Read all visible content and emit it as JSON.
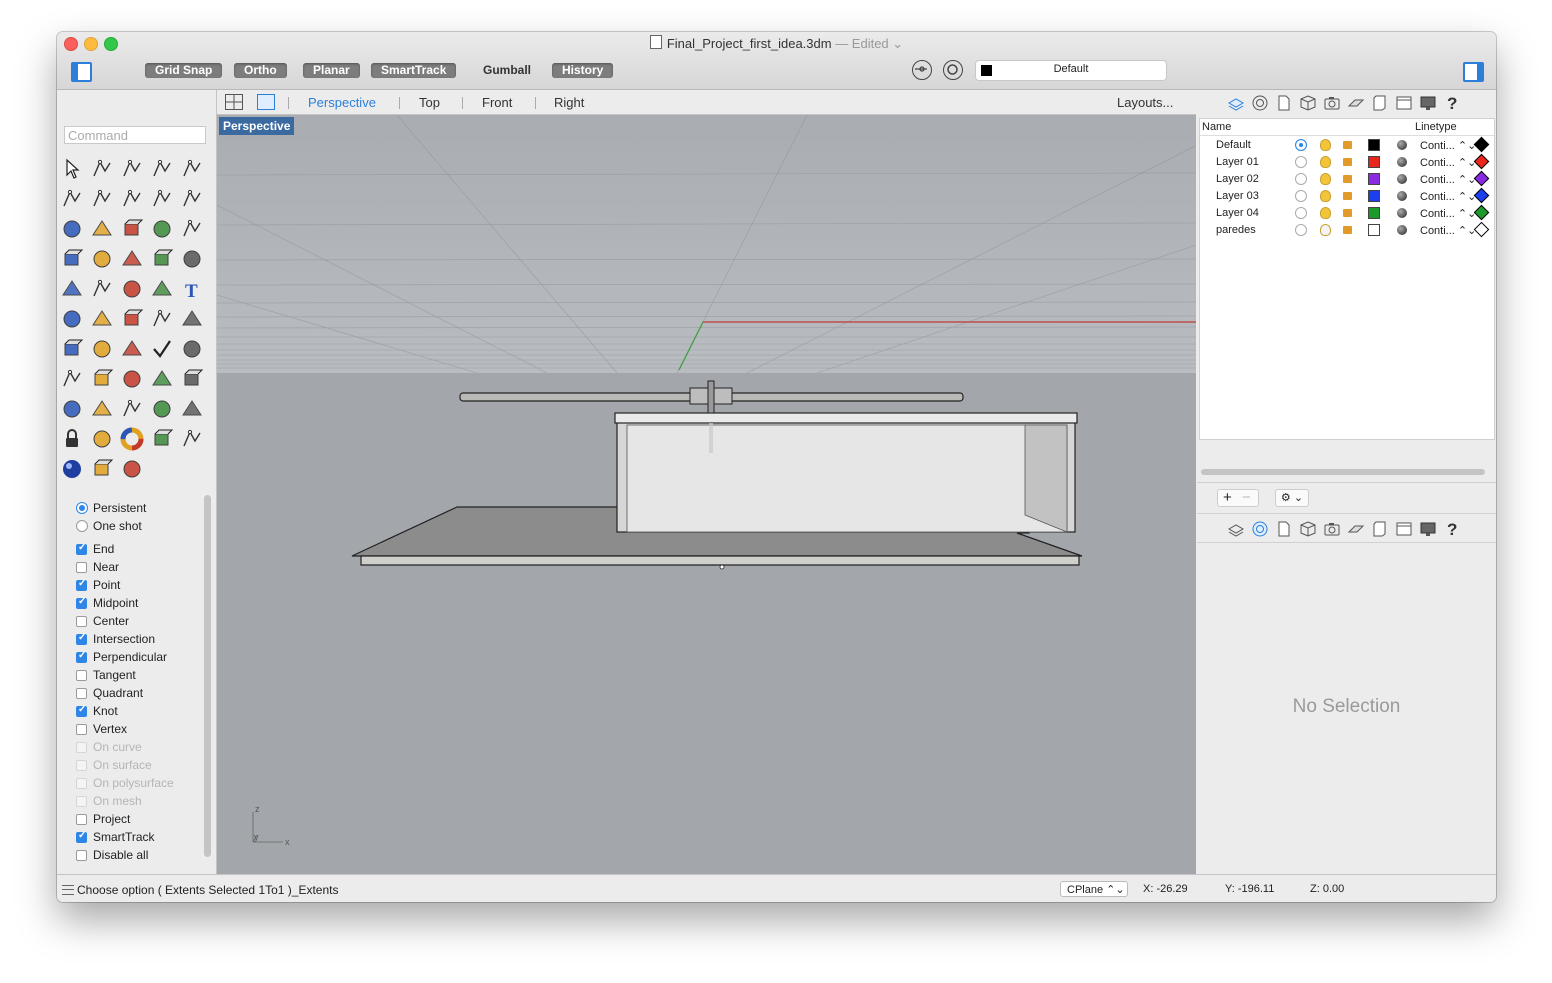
{
  "window": {
    "title": "Final_Project_first_idea.3dm",
    "edited": " — Edited ⌄"
  },
  "toolbar": {
    "grid_snap": "Grid Snap",
    "ortho": "Ortho",
    "planar": "Planar",
    "smarttrack": "SmartTrack",
    "gumball": "Gumball",
    "history": "History",
    "current_layer": "Default",
    "current_layer_color": "#000000"
  },
  "command": {
    "placeholder": "Command"
  },
  "tools": [
    "select-arrow-icon",
    "point-icon",
    "polyline-icon",
    "curve-icon",
    "circle-icon",
    "ellipse-icon",
    "arc-icon",
    "rectangle-icon",
    "polygon-icon",
    "fillet-icon",
    "surface-icon",
    "extrude-icon",
    "box-solid-icon",
    "sphere-icon",
    "cylinder-icon",
    "surface-edit-icon",
    "transform-puzzle-icon",
    "explode-icon",
    "split-icon",
    "offset-icon",
    "boolean-icon",
    "group-icon",
    "rotate-icon",
    "curve-from-object-icon",
    "text-icon",
    "scale-icon",
    "array-icon",
    "dimension-icon",
    "block-icon",
    "plane-icon",
    "grid-icon",
    "gumball-icon",
    "mesh-icon",
    "check-icon",
    "analyze-icon",
    "pan-icon",
    "zoom-icon",
    "zoom-window-icon",
    "zoom-extents-icon",
    "zoom-selected-icon",
    "named-view-icon",
    "car-render-icon",
    "texture-icon",
    "render-icon",
    "light-icon",
    "lock-icon",
    "section-icon",
    "color-wheel-icon",
    "sphere-display-icon",
    "globe-wire-icon",
    "material-ball-icon",
    "cone-icon",
    "layout-icon"
  ],
  "osnap": {
    "persistent": "Persistent",
    "one_shot": "One shot",
    "items": [
      {
        "label": "End",
        "checked": true,
        "enabled": true
      },
      {
        "label": "Near",
        "checked": false,
        "enabled": true
      },
      {
        "label": "Point",
        "checked": true,
        "enabled": true
      },
      {
        "label": "Midpoint",
        "checked": true,
        "enabled": true
      },
      {
        "label": "Center",
        "checked": false,
        "enabled": true
      },
      {
        "label": "Intersection",
        "checked": true,
        "enabled": true
      },
      {
        "label": "Perpendicular",
        "checked": true,
        "enabled": true
      },
      {
        "label": "Tangent",
        "checked": false,
        "enabled": true
      },
      {
        "label": "Quadrant",
        "checked": false,
        "enabled": true
      },
      {
        "label": "Knot",
        "checked": true,
        "enabled": true
      },
      {
        "label": "Vertex",
        "checked": false,
        "enabled": true
      },
      {
        "label": "On curve",
        "checked": false,
        "enabled": false
      },
      {
        "label": "On surface",
        "checked": false,
        "enabled": false
      },
      {
        "label": "On polysurface",
        "checked": false,
        "enabled": false
      },
      {
        "label": "On mesh",
        "checked": false,
        "enabled": false
      },
      {
        "label": "Project",
        "checked": false,
        "enabled": true
      },
      {
        "label": "SmartTrack",
        "checked": true,
        "enabled": true
      },
      {
        "label": "Disable all",
        "checked": false,
        "enabled": true
      }
    ]
  },
  "viewport_tabs": {
    "perspective": "Perspective",
    "top": "Top",
    "front": "Front",
    "right": "Right",
    "layouts": "Layouts..."
  },
  "viewport": {
    "label": "Perspective",
    "axis_z": "z",
    "axis_y": "y",
    "axis_x": "x"
  },
  "layers": {
    "col_name": "Name",
    "col_linetype": "Linetype",
    "rows": [
      {
        "name": "Default",
        "current": true,
        "color": "#000000",
        "linetype": "Conti... ⌃⌄",
        "print_color": "#000000"
      },
      {
        "name": "Layer 01",
        "current": false,
        "color": "#e8261b",
        "linetype": "Conti... ⌃⌄",
        "print_color": "#e8261b"
      },
      {
        "name": "Layer 02",
        "current": false,
        "color": "#8a2be2",
        "linetype": "Conti... ⌃⌄",
        "print_color": "#8a2be2"
      },
      {
        "name": "Layer 03",
        "current": false,
        "color": "#1c3ff0",
        "linetype": "Conti... ⌃⌄",
        "print_color": "#1c3ff0"
      },
      {
        "name": "Layer 04",
        "current": false,
        "color": "#1e9a2a",
        "linetype": "Conti... ⌃⌄",
        "print_color": "#1e9a2a"
      },
      {
        "name": "paredes",
        "current": false,
        "color": "#ffffff",
        "linetype": "Conti... ⌃⌄",
        "print_color": "#ffffff"
      }
    ],
    "add": "+",
    "remove": "−",
    "gear": "⚙ ⌄"
  },
  "properties": {
    "empty": "No Selection"
  },
  "status": {
    "message": "Choose option ( Extents Selected 1To1 )_Extents",
    "cplane": "CPlane ⌃⌄",
    "x": "X: -26.29",
    "y": "Y: -196.11",
    "z": "Z: 0.00"
  }
}
